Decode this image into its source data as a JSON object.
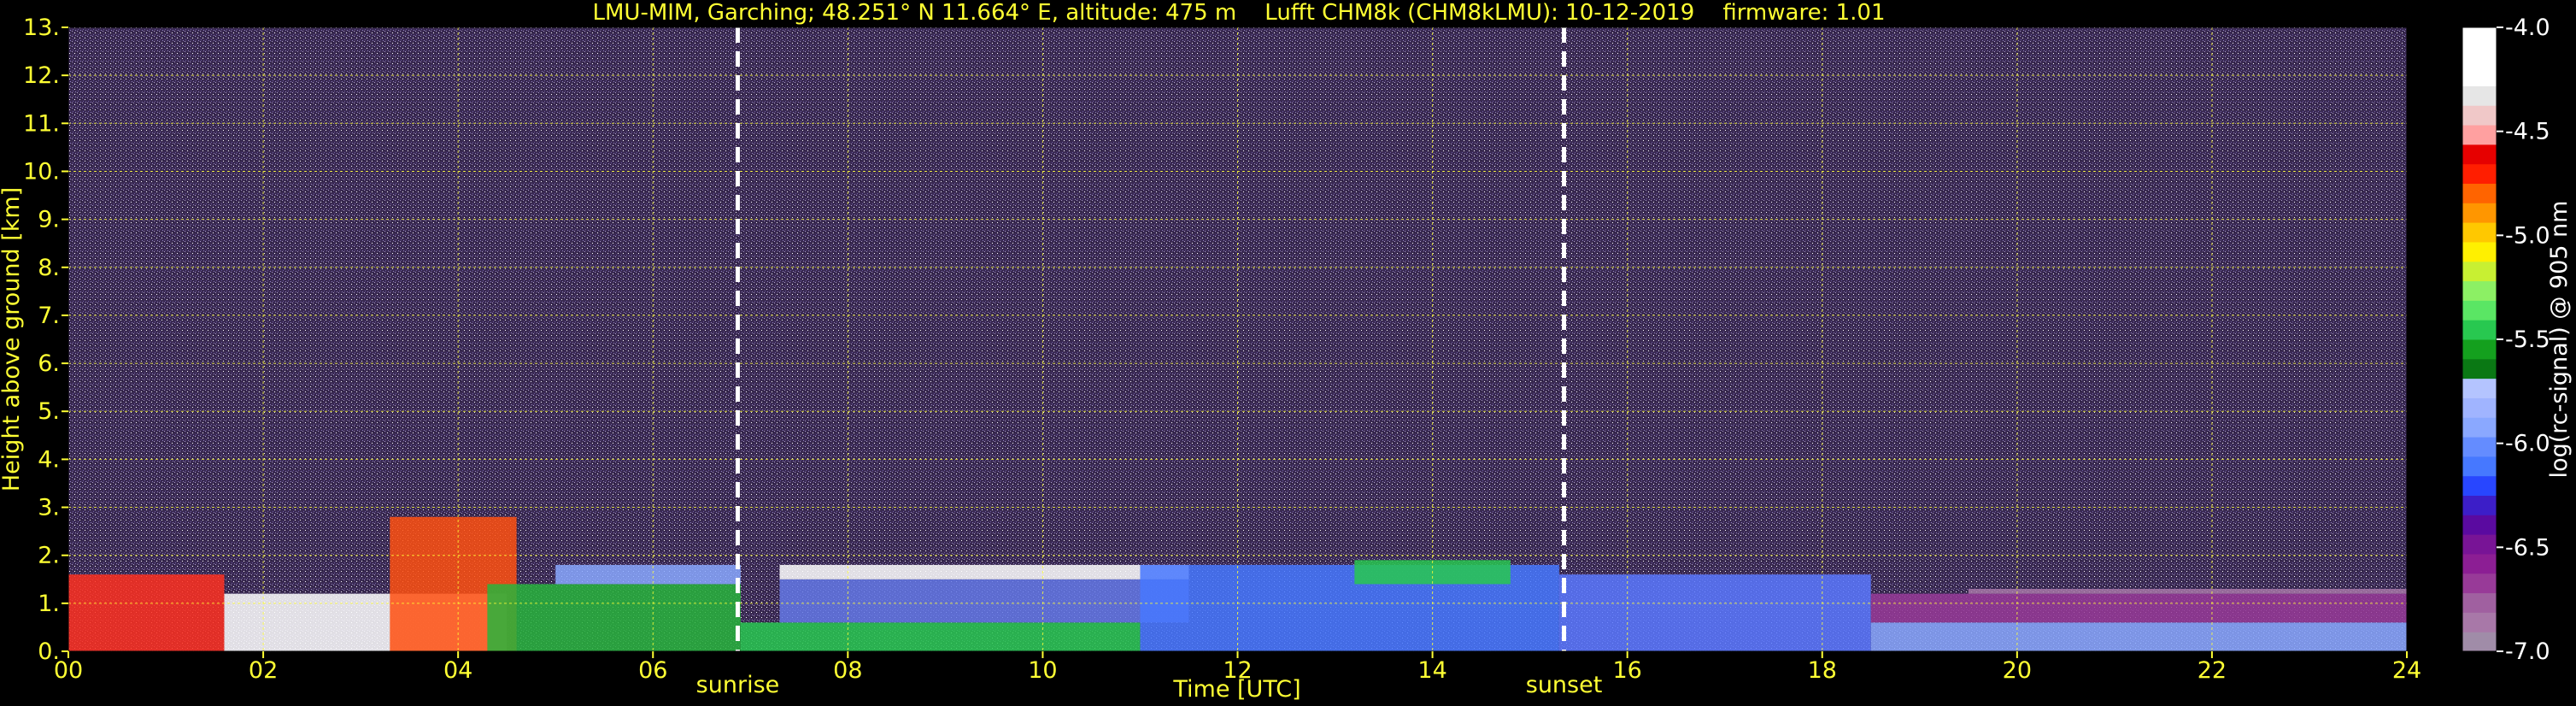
{
  "chart_data": {
    "type": "heatmap",
    "title": "LMU-MIM, Garching; 48.251° N 11.664° E, altitude: 475 m    Lufft CHM8k (CHM8kLMU): 10-12-2019    firmware: 1.01",
    "xlabel": "Time [UTC]",
    "ylabel": "Height above ground [km]",
    "colorbar_label": "log(rc-signal) @ 905 nm",
    "xlim": [
      0,
      24
    ],
    "ylim": [
      0,
      13
    ],
    "x_ticks": [
      0,
      2,
      4,
      6,
      8,
      10,
      12,
      14,
      16,
      18,
      20,
      22,
      24
    ],
    "x_tick_labels": [
      "00",
      "02",
      "04",
      "06",
      "08",
      "10",
      "12",
      "14",
      "16",
      "18",
      "20",
      "22",
      "24"
    ],
    "y_ticks": [
      0,
      1,
      2,
      3,
      4,
      5,
      6,
      7,
      8,
      9,
      10,
      11,
      12,
      13
    ],
    "y_tick_labels": [
      "0.",
      "1.",
      "2.",
      "3.",
      "4.",
      "5.",
      "6.",
      "7.",
      "8.",
      "9.",
      "10.",
      "11.",
      "12.",
      "13."
    ],
    "colorbar_range": [
      -7.0,
      -4.0
    ],
    "colorbar_ticks": [
      -7.0,
      -6.5,
      -6.0,
      -5.5,
      -5.0,
      -4.5,
      -4.0
    ],
    "colorbar_tick_labels": [
      "-7.0",
      "-6.5",
      "-6.0",
      "-5.5",
      "-5.0",
      "-4.5",
      "-4.0"
    ],
    "colorbar_colors": [
      "#a08ca8",
      "#a878a8",
      "#a060a0",
      "#983a98",
      "#8c1e94",
      "#781496",
      "#5a0aa0",
      "#3c1ec8",
      "#2846ff",
      "#4678ff",
      "#648cff",
      "#8aa8ff",
      "#a0b4ff",
      "#b4c4ff",
      "#0a7814",
      "#14a01e",
      "#28c850",
      "#5ae664",
      "#8cf064",
      "#c8f032",
      "#fff000",
      "#ffc800",
      "#ff9600",
      "#ff6400",
      "#ff1e00",
      "#e60000",
      "#ffa0a0",
      "#f0c8c8",
      "#e6e6e6",
      "#ffffff",
      "#ffffff",
      "#ffffff"
    ],
    "grid": true,
    "events": [
      {
        "label": "sunrise",
        "x": 6.87
      },
      {
        "label": "sunset",
        "x": 15.35
      }
    ],
    "background_noise_color": "#3a2a52",
    "accent_color": "#ffff33",
    "layers": [
      {
        "x0": 0.0,
        "x1": 1.6,
        "y0": 0.0,
        "y1": 1.6,
        "color": "#ff3020"
      },
      {
        "x0": 1.6,
        "x1": 4.5,
        "y0": 0.0,
        "y1": 1.2,
        "color": "#ffffff"
      },
      {
        "x0": 3.3,
        "x1": 4.6,
        "y0": 0.0,
        "y1": 2.8,
        "color": "#ff5010"
      },
      {
        "x0": 4.3,
        "x1": 6.9,
        "y0": 0.0,
        "y1": 1.4,
        "color": "#28b43c"
      },
      {
        "x0": 5.0,
        "x1": 6.9,
        "y0": 1.4,
        "y1": 1.8,
        "color": "#8aa8ff"
      },
      {
        "x0": 6.9,
        "x1": 11.0,
        "y0": 0.0,
        "y1": 0.6,
        "color": "#28c850"
      },
      {
        "x0": 7.3,
        "x1": 11.5,
        "y0": 0.6,
        "y1": 1.5,
        "color": "#6478e6"
      },
      {
        "x0": 7.3,
        "x1": 11.5,
        "y0": 1.5,
        "y1": 1.8,
        "color": "#ffffff"
      },
      {
        "x0": 11.0,
        "x1": 15.3,
        "y0": 0.0,
        "y1": 1.8,
        "color": "#4678ff"
      },
      {
        "x0": 13.2,
        "x1": 14.8,
        "y0": 1.4,
        "y1": 1.9,
        "color": "#28c850"
      },
      {
        "x0": 15.3,
        "x1": 18.5,
        "y0": 0.0,
        "y1": 1.6,
        "color": "#5a78ff"
      },
      {
        "x0": 18.5,
        "x1": 24.0,
        "y0": 0.0,
        "y1": 0.6,
        "color": "#8aa8ff"
      },
      {
        "x0": 18.5,
        "x1": 24.0,
        "y0": 0.6,
        "y1": 1.2,
        "color": "#983a98"
      },
      {
        "x0": 19.5,
        "x1": 24.0,
        "y0": 1.2,
        "y1": 1.3,
        "color": "#a878a8"
      }
    ]
  }
}
